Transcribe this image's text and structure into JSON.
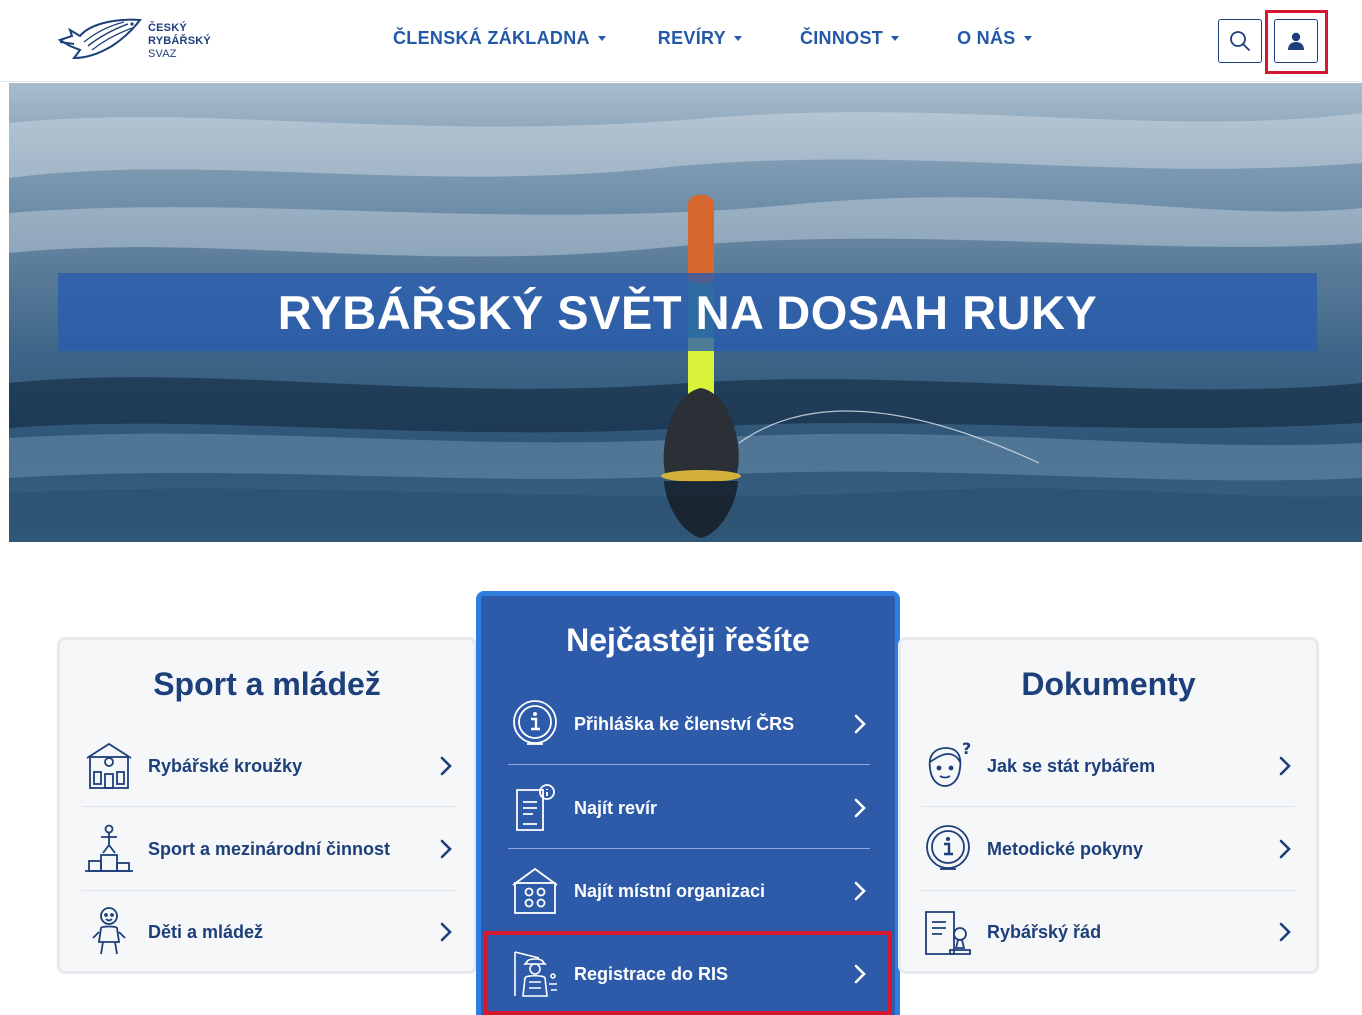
{
  "brand": {
    "line1": "ČESKÝ",
    "line2": "RYBÁŘSKÝ",
    "line3": "SVAZ"
  },
  "nav": {
    "items": [
      {
        "label": "ČLENSKÁ ZÁKLADNA"
      },
      {
        "label": "REVÍRY"
      },
      {
        "label": "ČINNOST"
      },
      {
        "label": "O NÁS"
      }
    ]
  },
  "icons": {
    "search": "search-icon",
    "user": "user-icon",
    "chevron": "chevron-right-icon"
  },
  "colors": {
    "brand_navy": "#1d3f7a",
    "nav_blue": "#2459a7",
    "center_card": "#2d5ba9",
    "highlight_red": "#d7172f"
  },
  "hero": {
    "title": "RYBÁŘSKÝ SVĚT NA DOSAH RUKY"
  },
  "sport": {
    "title": "Sport a mládež",
    "items": [
      {
        "label": "Rybářské kroužky",
        "icon": "house-icon"
      },
      {
        "label": "Sport a mezinárodní činnost",
        "icon": "podium-icon"
      },
      {
        "label": "Děti a mládež",
        "icon": "child-icon"
      }
    ]
  },
  "frequent": {
    "title": "Nejčastěji řešíte",
    "items": [
      {
        "label": "Přihláška ke členství ČRS",
        "icon": "info-icon"
      },
      {
        "label": "Najít revír",
        "icon": "document-info-icon"
      },
      {
        "label": "Najít místní organizaci",
        "icon": "organization-icon"
      },
      {
        "label": "Registrace do RIS",
        "icon": "fisherman-icon"
      }
    ]
  },
  "docs": {
    "title": "Dokumenty",
    "items": [
      {
        "label": "Jak se stát rybářem",
        "icon": "question-face-icon"
      },
      {
        "label": "Metodické pokyny",
        "icon": "info-icon"
      },
      {
        "label": "Rybářský řád",
        "icon": "document-stamp-icon"
      }
    ]
  }
}
